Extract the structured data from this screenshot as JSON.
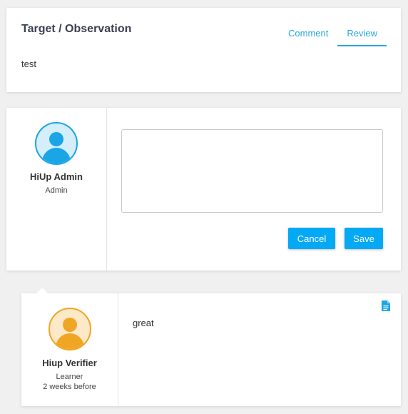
{
  "target": {
    "title": "Target / Observation",
    "description": "test",
    "tabs": [
      {
        "label": "Comment",
        "active": false
      },
      {
        "label": "Review",
        "active": true
      }
    ]
  },
  "compose": {
    "user": {
      "name": "HiUp Admin",
      "role": "Admin",
      "avatar_icon": "user-avatar-icon"
    },
    "comment_value": "",
    "cancel_label": "Cancel",
    "save_label": "Save"
  },
  "reply": {
    "user": {
      "name": "Hiup Verifier",
      "role": "Learner",
      "time": "2 weeks before",
      "avatar_icon": "user-avatar-icon"
    },
    "text": "great",
    "attachment_icon": "document-icon"
  },
  "colors": {
    "accent": "#2aa8db",
    "button": "#03a9f4",
    "avatar_blue": "#1aa5e6",
    "avatar_orange": "#f0a524"
  }
}
